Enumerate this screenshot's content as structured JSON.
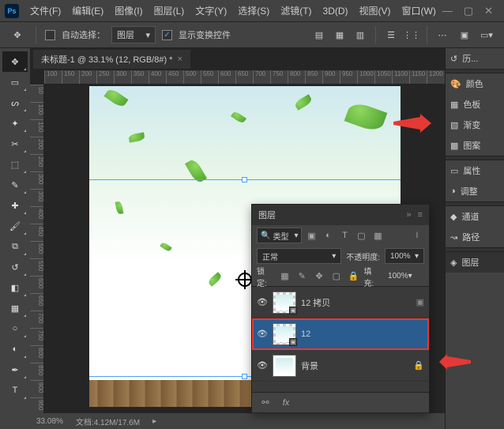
{
  "menubar": {
    "items": [
      "文件(F)",
      "编辑(E)",
      "图像(I)",
      "图层(L)",
      "文字(Y)",
      "选择(S)",
      "滤镜(T)",
      "3D(D)",
      "视图(V)",
      "窗口(W)"
    ]
  },
  "options": {
    "auto_select": "自动选择：",
    "layer_dd": "图层",
    "show_transform": "显示变换控件"
  },
  "document": {
    "tab_title": "未标题-1 @ 33.1% (12, RGB/8#) *",
    "zoom": "33.08%",
    "doc_size_label": "文档:",
    "doc_size_value": "4.12M/17.6M"
  },
  "ruler": {
    "h": [
      "100",
      "150",
      "200",
      "250",
      "300",
      "350",
      "400",
      "450",
      "500",
      "550",
      "600",
      "650",
      "700",
      "750",
      "800",
      "850",
      "900",
      "950",
      "1000",
      "1050",
      "1100",
      "1150",
      "1200"
    ],
    "v": [
      "50",
      "100",
      "150",
      "200",
      "250",
      "300",
      "350",
      "400",
      "450",
      "500",
      "550",
      "600",
      "650",
      "700",
      "750",
      "800",
      "850",
      "900",
      "950"
    ]
  },
  "right_panels": {
    "history": "历...",
    "color": "颜色",
    "swatches": "色板",
    "gradient": "渐变",
    "patterns": "图案",
    "properties": "属性",
    "adjust": "调整",
    "channels": "通道",
    "paths": "路径",
    "layers": "图层"
  },
  "layers_panel": {
    "title": "图层",
    "filter_label": "类型",
    "blend_mode": "正常",
    "opacity_label": "不透明度:",
    "opacity_value": "100%",
    "lock_label": "锁定:",
    "fill_label": "填充:",
    "fill_value": "100%",
    "items": [
      {
        "name": "12 拷贝"
      },
      {
        "name": "12"
      },
      {
        "name": "背景"
      }
    ]
  }
}
